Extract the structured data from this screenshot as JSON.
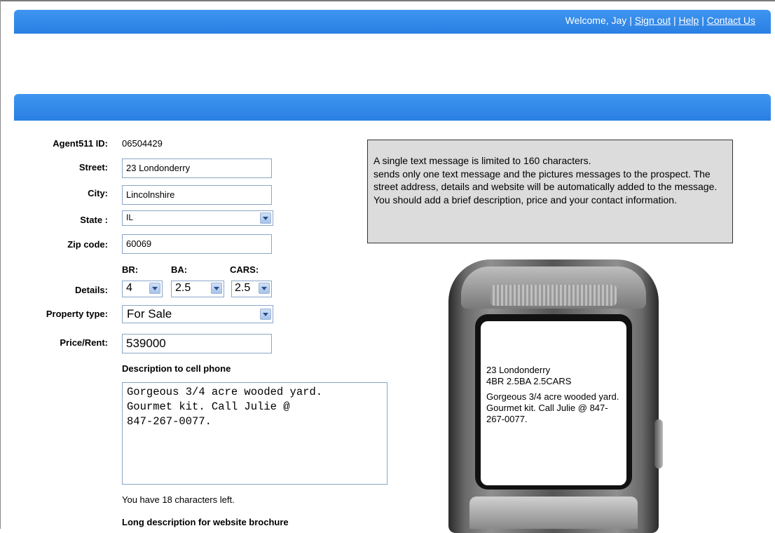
{
  "header": {
    "welcome": "Welcome, Jay",
    "sep": "|",
    "sign_out": "Sign out",
    "help": "Help",
    "contact_us": "Contact Us"
  },
  "form": {
    "agent_id_label": "Agent511 ID:",
    "agent_id_value": "06504429",
    "street_label": "Street:",
    "street_value": "23 Londonderry",
    "city_label": "City:",
    "city_value": "Lincolnshire",
    "state_label": "State :",
    "state_value": "IL",
    "zip_label": "Zip code:",
    "zip_value": "60069",
    "br_label": "BR:",
    "ba_label": "BA:",
    "cars_label": "CARS:",
    "details_label": "Details:",
    "br_value": "4",
    "ba_value": "2.5",
    "cars_value": "2.5",
    "property_type_label": "Property type:",
    "property_type_value": "For Sale",
    "price_label": "Price/Rent:",
    "price_value": "539000",
    "desc_label": "Description to cell phone",
    "desc_value": "Gorgeous 3/4 acre wooded yard.\nGourmet kit. Call Julie @\n847-267-0077.",
    "chars_left": "You have 18 characters left.",
    "long_desc_label": "Long description for website brochure"
  },
  "info": {
    "line1": "A single text message is limited to 160 characters.",
    "line2": "sends only one text message and the pictures messages to the prospect. The street address, details and website will be automatically added to the message. You should add a brief description, price and your contact information."
  },
  "phone": {
    "address": "23 Londonderry",
    "details": "4BR 2.5BA 2.5CARS",
    "message": "Gorgeous 3/4 acre wooded yard. Gourmet kit. Call Julie @ 847-267-0077."
  },
  "colors": {
    "header_blue": "#2a7fe3",
    "info_bg": "#dcdcdc"
  }
}
